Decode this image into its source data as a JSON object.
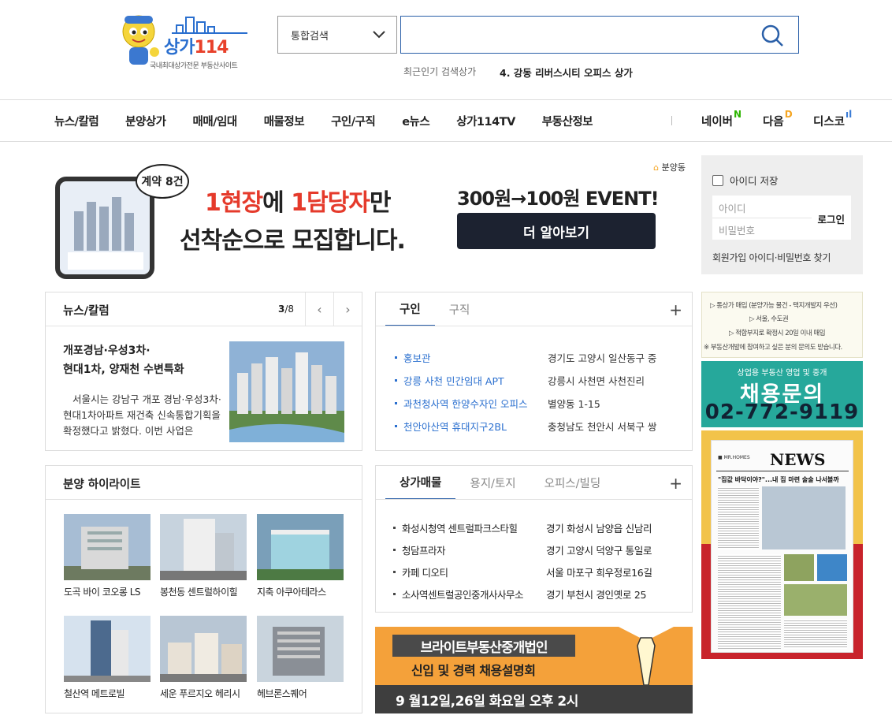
{
  "logo": {
    "brand": "상가",
    "brand_num": "114",
    "tagline": "국내최대상가전문 부동산사이트"
  },
  "search": {
    "select_value": "통합검색",
    "query": "",
    "placeholder": ""
  },
  "popular": {
    "label": "최근인기 검색상가",
    "item": "4. 강동 리버스시티 오피스 상가"
  },
  "nav": {
    "items": [
      "뉴스/칼럼",
      "분양상가",
      "매매/임대",
      "매물정보",
      "구인/구직",
      "e뉴스",
      "상가114TV",
      "부동산정보"
    ],
    "ext": [
      {
        "label": "네이버",
        "mark": "N",
        "color": "#2db400"
      },
      {
        "label": "다음",
        "mark": "D",
        "color": "#f5a623"
      },
      {
        "label": "디스코",
        "mark": "ıl",
        "color": "#3a7bd5"
      }
    ]
  },
  "banner": {
    "badge": "계약 8건",
    "line1_a": "1현장",
    "line1_b": "에 ",
    "line1_c": "1담당자",
    "line1_d": "만",
    "line2": "선착순으로 모집합니다.",
    "event": "300원→100원 EVENT!",
    "button": "더 알아보기",
    "tag": "분양동"
  },
  "login": {
    "save_label": "아이디 저장",
    "id_placeholder": "아이디",
    "pw_placeholder": "비밀번호",
    "login_button": "로그인",
    "links": "회원가입 아이디·비밀번호 찾기"
  },
  "news": {
    "title": "뉴스/칼럼",
    "page_current": "3",
    "page_total": "/8",
    "headline_1": "개포경남·우성3차·",
    "headline_2": "현대1차, 양재천 수변특화",
    "body": "서울시는 강남구 개포 경남·우성3차·현대1차아파트 재건축 신속통합기획을 확정했다고 밝혔다. 이번 사업은"
  },
  "gu": {
    "tabs": [
      "구인",
      "구직"
    ],
    "plus": "+",
    "rows": [
      {
        "left": "홍보관",
        "right": "경기도 고양시 일산동구 중"
      },
      {
        "left": "강릉 사천 민간임대 APT",
        "right": "강릉시 사천면 사천진리"
      },
      {
        "left": "과천청사역 한양수자인 오피스",
        "right": "별양동 1-15"
      },
      {
        "left": "천안아산역 휴대지구2BL",
        "right": "충청남도 천안시 서북구 쌍"
      }
    ]
  },
  "highlight": {
    "title": "분양 하이라이트",
    "items": [
      {
        "caption": "도곡 바이 코오롱 LS"
      },
      {
        "caption": "봉천동 센트럴하이힐"
      },
      {
        "caption": "지축 아쿠아테라스"
      },
      {
        "caption": "철산역 메트로빌"
      },
      {
        "caption": "세운 푸르지오 헤리시"
      },
      {
        "caption": "헤브론스퀘어"
      }
    ]
  },
  "sm": {
    "tabs": [
      "상가매물",
      "용지/토지",
      "오피스/빌딩"
    ],
    "plus": "+",
    "rows": [
      {
        "left": "화성시청역 센트럴파크스타힐",
        "right": "경기 화성시 남양읍 신남리"
      },
      {
        "left": "청담프라자",
        "right": "경기 고양시 덕양구 통일로"
      },
      {
        "left": "카페 디오티",
        "right": "서울 마포구 희우정로16길"
      },
      {
        "left": "소사역센트럴공인중개사사무소",
        "right": "경기 부천시 경인옛로 25"
      }
    ]
  },
  "orange_ad": {
    "line1": "브라이트부동산중개법인",
    "line2": "신입 및 경력 채용설명회",
    "line3": "9 월12일,26일 화요일 오후 2시"
  },
  "right_ads": {
    "ad1_lines": [
      "▷ 통상가 매입 (분양가능 물건 - 택지개발지 우선)",
      "▷ 서울, 수도권",
      "▷ 적합부지로 확정시 20일 이내 매입",
      "※ 부동산개발에 참여하고 싶은 분의 문의도 받습니다."
    ],
    "ad2_small": "상업용 부동산 영업 및 중개",
    "ad2_big": "채용문의",
    "ad2_phone": "02-772-9119",
    "ad3_title": "NEWS",
    "ad3_headline": "\"집값 바닥이야?\"...내 집 마련 술술 나서볼까"
  }
}
